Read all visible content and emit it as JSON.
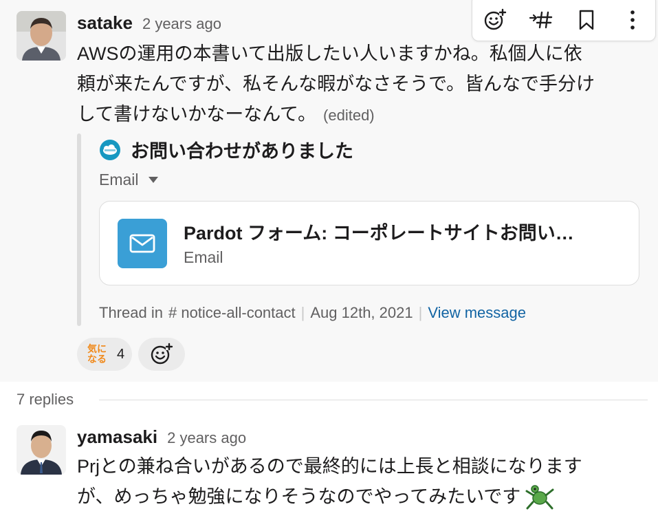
{
  "parent": {
    "author": "satake",
    "time": "2 years ago",
    "text_lines": [
      "AWSの運用の本書いて出版したい人いますかね。私個人に依",
      "頼が来たんですが、私そんな暇がなさそうで。皆んなで手分け",
      "して書けないかなーなんて。"
    ],
    "edited": "(edited)",
    "toolbar": {
      "icons": [
        "add-reaction-icon",
        "forward-channel-icon",
        "bookmark-icon",
        "more-actions-icon"
      ]
    },
    "attachment": {
      "title": "お問い合わせがありました",
      "source_icon": "salesforce-icon",
      "email_label": "Email",
      "file": {
        "name": "Pardot フォーム: コーポレートサイトお問い…",
        "type": "Email"
      },
      "meta": {
        "thread_in": "Thread in",
        "channel": "notice-all-contact",
        "date": "Aug 12th, 2021",
        "view_message": "View message"
      }
    },
    "reactions": [
      {
        "emoji_text": "気に なる",
        "count": "4"
      }
    ]
  },
  "replies_count": "7 replies",
  "reply": {
    "author": "yamasaki",
    "time": "2 years ago",
    "text_lines": [
      "Prjとの兼ね合いがあるので最終的には上長と相談になります",
      "が、めっちゃ勉強になりそうなのでやってみたいです"
    ]
  },
  "colors": {
    "link": "#1264a3",
    "file_icon_bg": "#3a9fd6",
    "salesforce": "#1798c1",
    "reaction_text": "#f08a1c"
  }
}
